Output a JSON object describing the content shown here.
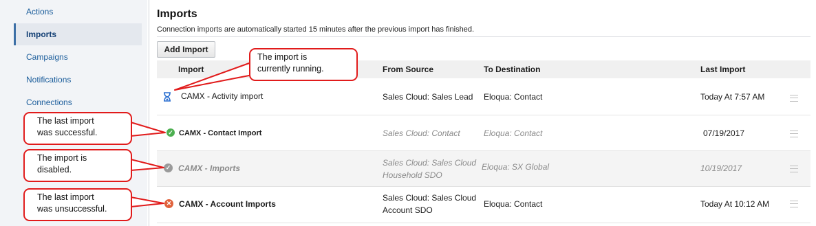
{
  "sidebar": {
    "items": [
      {
        "label": "Actions"
      },
      {
        "label": "Imports"
      },
      {
        "label": "Campaigns"
      },
      {
        "label": "Notifications"
      },
      {
        "label": "Connections"
      }
    ]
  },
  "main": {
    "title": "Imports",
    "subtitle": "Connection imports are automatically started 15 minutes after the previous import has finished.",
    "add_button": "Add Import",
    "columns": [
      "Import",
      "From Source",
      "To Destination",
      "Last Import"
    ],
    "rows": [
      {
        "status_icon": "hourglass-icon",
        "name": "CAMX - Activity import",
        "source": "Sales Cloud: Sales Lead",
        "destination": "Eloqua: Contact",
        "last_import": "Today At 7:57 AM"
      },
      {
        "status_icon": "check-circle-icon",
        "name": "CAMX - Contact Import",
        "source": "Sales Cloud: Contact",
        "destination": "Eloqua: Contact",
        "last_import": "07/19/2017"
      },
      {
        "status_icon": "disabled-check-icon",
        "name": "CAMX - Imports",
        "source_line1": "Sales Cloud: Sales Cloud",
        "source_line2": "Household SDO",
        "destination": "Eloqua: SX Global",
        "last_import": "10/19/2017"
      },
      {
        "status_icon": "error-x-icon",
        "name": "CAMX - Account Imports",
        "source_line1": "Sales Cloud: Sales Cloud",
        "source_line2": "Account SDO",
        "destination": "Eloqua: Contact",
        "last_import": "Today At 10:12 AM"
      }
    ]
  },
  "callouts": {
    "running": {
      "line1": "The import is",
      "line2": "currently running."
    },
    "successful": {
      "line1": "The last import",
      "line2": "was successful."
    },
    "disabled": {
      "line1": "The import is",
      "line2": "disabled."
    },
    "unsuccessful": {
      "line1": "The last import",
      "line2": "was unsuccessful."
    }
  },
  "colors": {
    "running": "#2a6fd1",
    "success": "#4caf50",
    "disabled": "#9a9a9a",
    "error": "#e0623c",
    "callout_border": "#e11b1b"
  }
}
